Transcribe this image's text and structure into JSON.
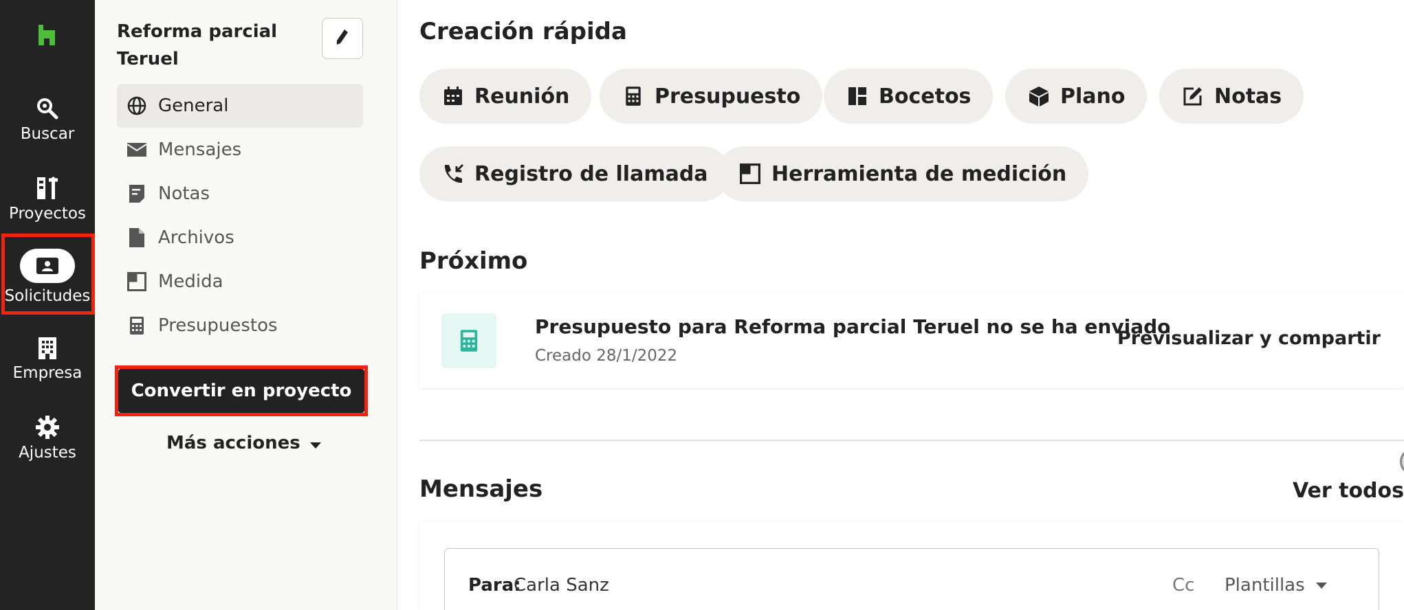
{
  "rail": {
    "logo_color": "#4dbd3b",
    "items": [
      {
        "label": "Buscar",
        "icon": "search-icon"
      },
      {
        "label": "Proyectos",
        "icon": "projects-icon"
      },
      {
        "label": "Solicitudes",
        "icon": "requests-icon",
        "active": true
      },
      {
        "label": "Empresa",
        "icon": "building-icon"
      },
      {
        "label": "Ajustes",
        "icon": "gear-icon"
      }
    ]
  },
  "sidebar": {
    "title": "Reforma parcial Teruel",
    "items": [
      {
        "label": "General",
        "icon": "globe-icon",
        "active": true
      },
      {
        "label": "Mensajes",
        "icon": "mail-icon"
      },
      {
        "label": "Notas",
        "icon": "note-icon"
      },
      {
        "label": "Archivos",
        "icon": "file-icon"
      },
      {
        "label": "Medida",
        "icon": "measure-icon"
      },
      {
        "label": "Presupuestos",
        "icon": "calculator-icon"
      }
    ],
    "convert_label": "Convertir en proyecto",
    "more_actions_label": "Más acciones"
  },
  "main": {
    "quick_create_title": "Creación rápida",
    "chips": [
      {
        "label": "Reunión",
        "icon": "calendar-icon"
      },
      {
        "label": "Presupuesto",
        "icon": "calculator-icon"
      },
      {
        "label": "Bocetos",
        "icon": "layout-icon"
      },
      {
        "label": "Plano",
        "icon": "box-icon"
      },
      {
        "label": "Notas",
        "icon": "edit-icon"
      },
      {
        "label": "Registro de llamada",
        "icon": "call-log-icon"
      },
      {
        "label": "Herramienta de medición",
        "icon": "measure-icon"
      }
    ],
    "upcoming_title": "Próximo",
    "upcoming": {
      "title": "Presupuesto para Reforma parcial Teruel no se ha enviado",
      "subtitle": "Creado 28/1/2022",
      "action": "Previsualizar y compartir",
      "icon_color": "#2bb59a"
    },
    "messages_title": "Mensajes",
    "see_all": "Ver todos",
    "compose": {
      "to_label": "Para:",
      "to_value": "Carla Sanz",
      "cc_label": "Cc",
      "templates_label": "Plantillas"
    }
  },
  "highlight_color": "#f2230f"
}
